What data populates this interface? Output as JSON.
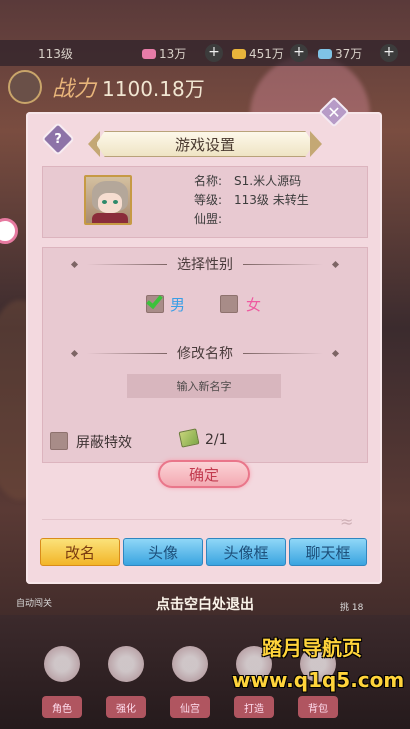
{
  "hud": {
    "level": "113级",
    "resource_1": "13万",
    "resource_2": "451万",
    "resource_3": "37万",
    "plus_symbol": "+",
    "power_label": "战力",
    "power_value": "1100.18万"
  },
  "dialog": {
    "title": "游戏设置",
    "help_symbol": "?",
    "close_symbol": "✕",
    "info": {
      "name_key": "名称:",
      "name_value": "S1.米人源码",
      "level_key": "等级:",
      "level_value": "113级 未转生",
      "guild_key": "仙盟:",
      "guild_value": ""
    },
    "gender": {
      "header": "选择性别",
      "male": "男",
      "female": "女",
      "selected": "男"
    },
    "rename": {
      "header": "修改名称",
      "placeholder": "输入新名字"
    },
    "effects": {
      "label": "屏蔽特效",
      "count": "2/1"
    },
    "confirm": "确定"
  },
  "tabs": [
    {
      "label": "改名",
      "active": true
    },
    {
      "label": "头像",
      "active": false
    },
    {
      "label": "头像框",
      "active": false
    },
    {
      "label": "聊天框",
      "active": false
    }
  ],
  "exit_hint": "点击空白处退出",
  "bottom_left_hint": "自动闯关",
  "bottom_right_hint": "挑 18",
  "bottom_bar": [
    "角色",
    "强化",
    "仙宫",
    "打造",
    "背包"
  ],
  "watermark": {
    "line1": "踏月导航页",
    "line2": "www.q1q5.com"
  },
  "colors": {
    "dialog_bg": "#f3d9df",
    "tab_active": "#f2b528",
    "tab_normal": "#3aa4e0",
    "confirm_text": "#c23a4e",
    "male_label": "#3a9ee6",
    "female_label": "#ee5aa0",
    "check_tick": "#3cc23c"
  }
}
